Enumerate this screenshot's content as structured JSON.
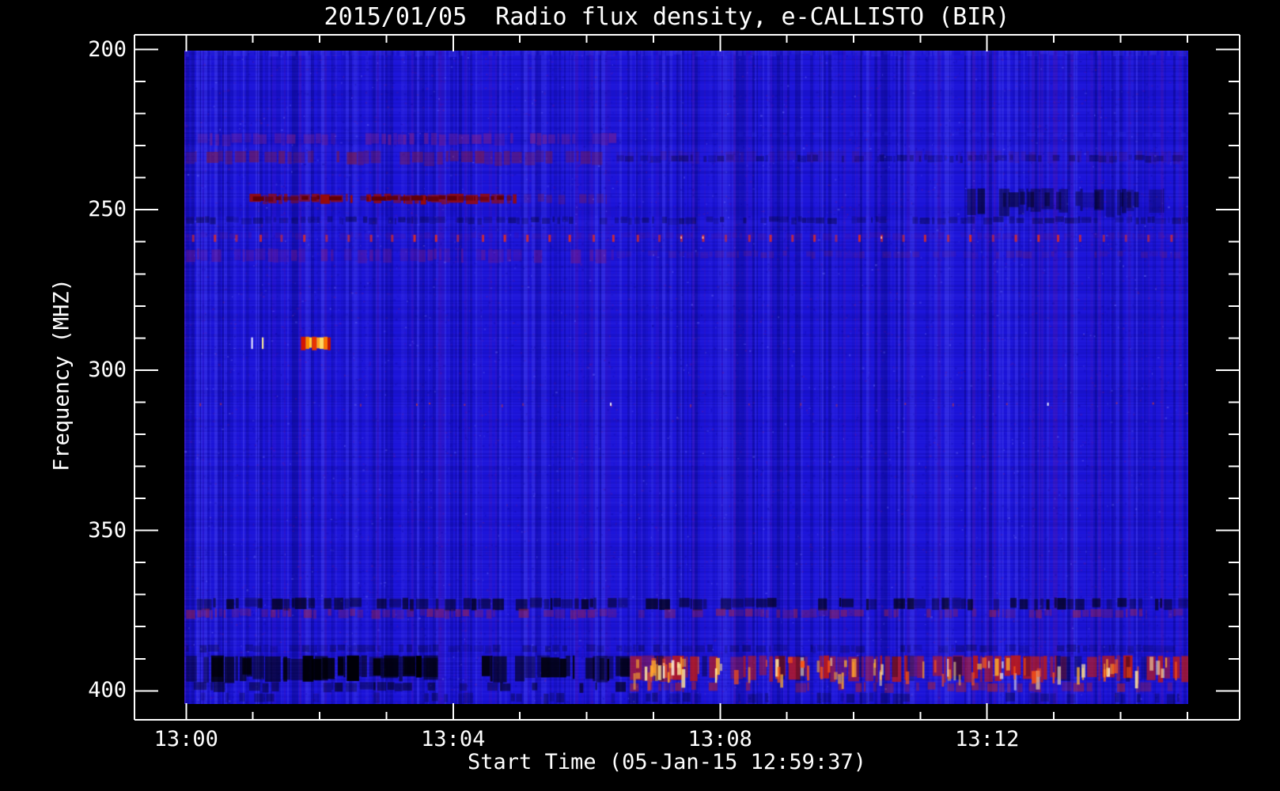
{
  "title": "2015/01/05  Radio flux density, e-CALLISTO (BIR)",
  "x_axis": {
    "label": "Start Time (05-Jan-15 12:59:37)",
    "major_tick_labels": [
      "13:00",
      "13:04",
      "13:08",
      "13:12"
    ],
    "major_interval_minutes": 4,
    "minors_per_minute": 1,
    "range_minutes_from_1300": [
      -0.77,
      15.78
    ]
  },
  "y_axis": {
    "label": "Frequency (MHZ)",
    "major_tick_labels": [
      "200",
      "250",
      "300",
      "350",
      "400"
    ],
    "minor_step_mhz": 10,
    "range_mhz": [
      195.4,
      409.0
    ]
  },
  "colors": {
    "background": "#000000",
    "axis": "#ffffff",
    "text": "#ffffff",
    "base_blue": "#1c14da",
    "hot_red": "#d42010",
    "hot_orange": "#ff8b00",
    "hot_yellow": "#ffd862"
  },
  "chart_data": {
    "type": "heatmap",
    "title": "2015/01/05  Radio flux density, e-CALLISTO (BIR)",
    "xlabel": "Start Time (05-Jan-15 12:59:37)",
    "ylabel": "Frequency (MHZ)",
    "x_ticks": [
      "13:00",
      "13:04",
      "13:08",
      "13:12"
    ],
    "y_ticks": [
      200,
      250,
      300,
      350,
      400
    ],
    "image_span": {
      "time_minutes_from_1300": [
        0,
        15.03
      ],
      "freq_mhz": [
        200.4,
        404
      ]
    },
    "description": "Solar radio spectrogram, blue background noise with horizontal RFI bands, a short bright burst near 291 MHz at ~13:01:45, and a strong low band near 390-400 MHz that is dark before ~13:06:40 and bright red after.",
    "features": [
      {
        "type": "band",
        "name": "bright-top-row",
        "f0": 200.3,
        "f1": 202.0,
        "m0": 0,
        "m1": 15.03,
        "color": [
          80,
          80,
          255
        ],
        "alpha": 0.25,
        "density": 0.9,
        "dash": 10
      },
      {
        "type": "band",
        "name": "purple-band-227-left",
        "f0": 226.3,
        "f1": 229.8,
        "m0": 0,
        "m1": 6.45,
        "color": [
          150,
          35,
          125
        ],
        "alpha": 0.42,
        "density": 0.78,
        "dash": 12
      },
      {
        "type": "band",
        "name": "bright-row-226-right",
        "f0": 225.8,
        "f1": 227.2,
        "m0": 6.45,
        "m1": 15.03,
        "color": [
          60,
          60,
          255
        ],
        "alpha": 0.2,
        "density": 0.7,
        "dash": 10
      },
      {
        "type": "band",
        "name": "brick-band-233-left",
        "f0": 231.8,
        "f1": 235.8,
        "m0": 0,
        "m1": 6.45,
        "color": [
          135,
          25,
          55
        ],
        "alpha": 0.5,
        "density": 0.8,
        "dash": 14
      },
      {
        "type": "band",
        "name": "faint-band-233-right",
        "f0": 231.8,
        "f1": 235.2,
        "m0": 6.45,
        "m1": 15.03,
        "color": [
          120,
          20,
          70
        ],
        "alpha": 0.16,
        "density": 0.7,
        "dash": 12
      },
      {
        "type": "band",
        "name": "dark-row-234-right",
        "f0": 233.0,
        "f1": 235.0,
        "m0": 6.45,
        "m1": 15.03,
        "color": [
          0,
          0,
          30
        ],
        "alpha": 0.3,
        "density": 0.7,
        "dash": 12
      },
      {
        "type": "band",
        "name": "dark-red-streak-246",
        "f0": 245.2,
        "f1": 247.9,
        "m0": 0.95,
        "m1": 4.95,
        "color": [
          150,
          10,
          10
        ],
        "alpha": 0.95,
        "density": 0.97,
        "dash": 16
      },
      {
        "type": "band",
        "name": "dark-red-streak-246-core",
        "f0": 245.8,
        "f1": 247.2,
        "m0": 1.0,
        "m1": 4.9,
        "color": [
          95,
          0,
          5
        ],
        "alpha": 0.9,
        "density": 0.95,
        "dash": 18
      },
      {
        "type": "band",
        "name": "streak-tail-246",
        "f0": 245.2,
        "f1": 247.9,
        "m0": 4.95,
        "m1": 6.3,
        "color": [
          140,
          25,
          60
        ],
        "alpha": 0.3,
        "density": 0.6,
        "dash": 10
      },
      {
        "type": "band",
        "name": "black-patches-248-right",
        "f0": 243.5,
        "f1": 251.5,
        "m0": 11.7,
        "m1": 14.65,
        "color": [
          0,
          0,
          12
        ],
        "alpha": 0.5,
        "density": 0.55,
        "dash": 16
      },
      {
        "type": "band",
        "name": "black-patches-248-right-b",
        "f0": 244.5,
        "f1": 249.5,
        "m0": 12.1,
        "m1": 14.3,
        "color": [
          0,
          0,
          8
        ],
        "alpha": 0.45,
        "density": 0.5,
        "dash": 14
      },
      {
        "type": "band",
        "name": "dark-row-253",
        "f0": 252.3,
        "f1": 254.3,
        "m0": 0,
        "m1": 15.03,
        "color": [
          0,
          0,
          30
        ],
        "alpha": 0.34,
        "density": 0.75,
        "dash": 12
      },
      {
        "type": "band",
        "name": "purple-row-258",
        "f0": 257.2,
        "f1": 259.2,
        "m0": 0,
        "m1": 15.03,
        "color": [
          120,
          10,
          90
        ],
        "alpha": 0.16,
        "density": 0.7,
        "dash": 10
      },
      {
        "type": "tickrow",
        "name": "periodic-rfi-dashes-258",
        "f": 257.8,
        "h": 2.2,
        "m0": 0.08,
        "m1": 15.0,
        "step": 0.333,
        "color": [
          235,
          45,
          28
        ],
        "alpha": 0.88,
        "w": 3
      },
      {
        "type": "band",
        "name": "purple-band-264-left",
        "f0": 262.3,
        "f1": 266.3,
        "m0": 0,
        "m1": 6.45,
        "color": [
          135,
          25,
          120
        ],
        "alpha": 0.38,
        "density": 0.75,
        "dash": 12
      },
      {
        "type": "band",
        "name": "red-dash-row-264-right",
        "f0": 263.0,
        "f1": 265.0,
        "m0": 6.45,
        "m1": 15.03,
        "color": [
          150,
          30,
          60
        ],
        "alpha": 0.2,
        "density": 0.6,
        "dash": 10
      },
      {
        "type": "rects",
        "name": "burst-291",
        "items": [
          [
            0.975,
            1.0,
            289.8,
            293.4,
            "#e9e9ff"
          ],
          [
            1.135,
            1.16,
            289.8,
            293.4,
            "#ffef9a"
          ],
          [
            1.72,
            1.79,
            289.6,
            293.8,
            "#d41400"
          ],
          [
            1.79,
            1.845,
            289.6,
            293.4,
            "#ff8b00"
          ],
          [
            1.845,
            1.885,
            289.8,
            293.0,
            "#ffcf3d"
          ],
          [
            1.885,
            1.955,
            289.6,
            293.8,
            "#e83200"
          ],
          [
            1.955,
            2.0,
            289.8,
            293.2,
            "#ffa41e"
          ],
          [
            2.0,
            2.06,
            289.8,
            293.4,
            "#ffd862"
          ],
          [
            2.06,
            2.12,
            289.6,
            293.6,
            "#ff7300"
          ],
          [
            2.12,
            2.165,
            289.8,
            293.8,
            "#c01000"
          ]
        ]
      },
      {
        "type": "dotrow",
        "name": "sparse-dots-310",
        "f": 310.4,
        "m0": 0.2,
        "m1": 15.0,
        "color": [
          220,
          55,
          40
        ],
        "alpha": 0.75,
        "white_dots_m": [
          6.35,
          12.9
        ]
      },
      {
        "type": "band",
        "name": "band-372-black",
        "f0": 371.2,
        "f1": 374.6,
        "m0": 0,
        "m1": 15.03,
        "color": [
          0,
          0,
          5
        ],
        "alpha": 0.62,
        "density": 0.72,
        "dash": 14
      },
      {
        "type": "band",
        "name": "band-375-red",
        "f0": 374.6,
        "f1": 377.2,
        "m0": 0,
        "m1": 15.03,
        "color": [
          165,
          35,
          65
        ],
        "alpha": 0.45,
        "density": 0.75,
        "dash": 12
      },
      {
        "type": "band",
        "name": "row-387-dark",
        "f0": 385.8,
        "f1": 388.0,
        "m0": 0,
        "m1": 15.03,
        "color": [
          0,
          0,
          25
        ],
        "alpha": 0.28,
        "density": 0.7,
        "dash": 12
      },
      {
        "type": "band",
        "name": "bottom-black-band",
        "f0": 389.2,
        "f1": 396.8,
        "m0": 0,
        "m1": 6.65,
        "color": [
          0,
          0,
          6
        ],
        "alpha": 0.85,
        "density": 0.8,
        "dash": 18
      },
      {
        "type": "band",
        "name": "bottom-black-band-b",
        "f0": 389.8,
        "f1": 396.0,
        "m0": 0,
        "m1": 6.65,
        "color": [
          0,
          0,
          3
        ],
        "alpha": 0.8,
        "density": 0.6,
        "dash": 22
      },
      {
        "type": "band",
        "name": "bottom-black-row2",
        "f0": 397.5,
        "f1": 400.3,
        "m0": 0,
        "m1": 6.65,
        "color": [
          0,
          0,
          10
        ],
        "alpha": 0.55,
        "density": 0.6,
        "dash": 16
      },
      {
        "type": "band",
        "name": "bottom-dark-row3",
        "f0": 400.8,
        "f1": 403.8,
        "m0": 0,
        "m1": 15.03,
        "color": [
          0,
          0,
          15
        ],
        "alpha": 0.3,
        "density": 0.45,
        "dash": 12
      },
      {
        "type": "band",
        "name": "bottom-red-band",
        "f0": 389.2,
        "f1": 396.8,
        "m0": 6.65,
        "m1": 15.03,
        "color": [
          200,
          25,
          12
        ],
        "alpha": 0.72,
        "density": 0.85,
        "dash": 14
      },
      {
        "type": "band",
        "name": "bottom-red-row2",
        "f0": 397.5,
        "f1": 400.3,
        "m0": 6.65,
        "m1": 15.03,
        "color": [
          195,
          35,
          25
        ],
        "alpha": 0.45,
        "density": 0.6,
        "dash": 12
      },
      {
        "type": "band",
        "name": "bottom-red-dark-gaps",
        "f0": 389.2,
        "f1": 397.0,
        "m0": 6.65,
        "m1": 15.03,
        "color": [
          0,
          0,
          20
        ],
        "alpha": 0.4,
        "density": 0.25,
        "dash": 10
      },
      {
        "type": "hotspots",
        "name": "bottom-hot-spots",
        "f0": 389.3,
        "f1": 396.5,
        "m0": 6.7,
        "m1": 15.0,
        "count": 85
      },
      {
        "type": "hotspots",
        "name": "bottom-hot-cluster",
        "f0": 389.5,
        "f1": 394.5,
        "m0": 6.95,
        "m1": 7.45,
        "count": 14
      }
    ]
  }
}
